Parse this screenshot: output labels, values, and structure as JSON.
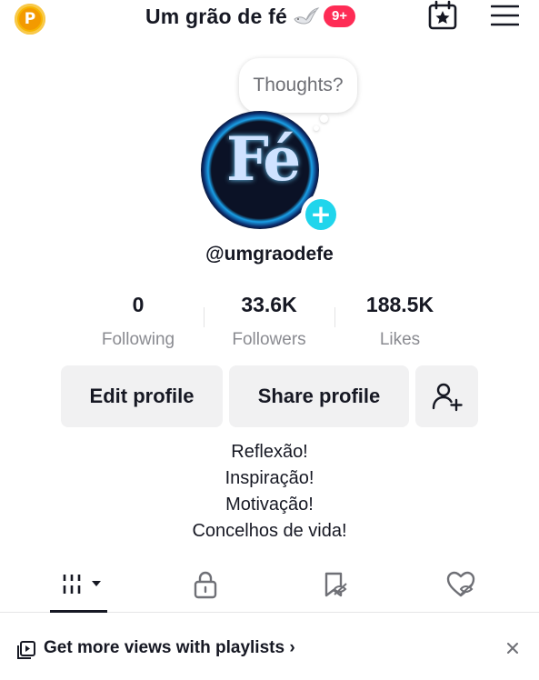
{
  "header": {
    "title": "Um grão de fé",
    "notification_badge": "9+",
    "coin_label": "P",
    "coin_icon": "tiktok-coin-icon",
    "calendar_icon": "calendar-star-icon",
    "menu_icon": "hamburger-menu-icon",
    "accent": "#fe2c55"
  },
  "profile": {
    "thought_bubble": "Thoughts?",
    "avatar_text": "Fé",
    "add_story_label": "+",
    "username": "@umgraodefe"
  },
  "stats": [
    {
      "value": "0",
      "label": "Following"
    },
    {
      "value": "33.6K",
      "label": "Followers"
    },
    {
      "value": "188.5K",
      "label": "Likes"
    }
  ],
  "actions": {
    "edit_profile": "Edit profile",
    "share_profile": "Share profile",
    "add_friends_icon": "add-user-icon"
  },
  "bio": [
    "Reflexão!",
    "Inspiração!",
    "Motivação!",
    "Concelhos de vida!"
  ],
  "tabs": [
    {
      "icon": "videos-grid-icon",
      "active": true
    },
    {
      "icon": "lock-icon",
      "active": false
    },
    {
      "icon": "bookmark-icon",
      "active": false
    },
    {
      "icon": "liked-heart-icon",
      "active": false
    }
  ],
  "banner": {
    "text": "Get more views with playlists",
    "chevron": "›",
    "icon": "playlist-icon",
    "close_icon": "close-icon"
  }
}
